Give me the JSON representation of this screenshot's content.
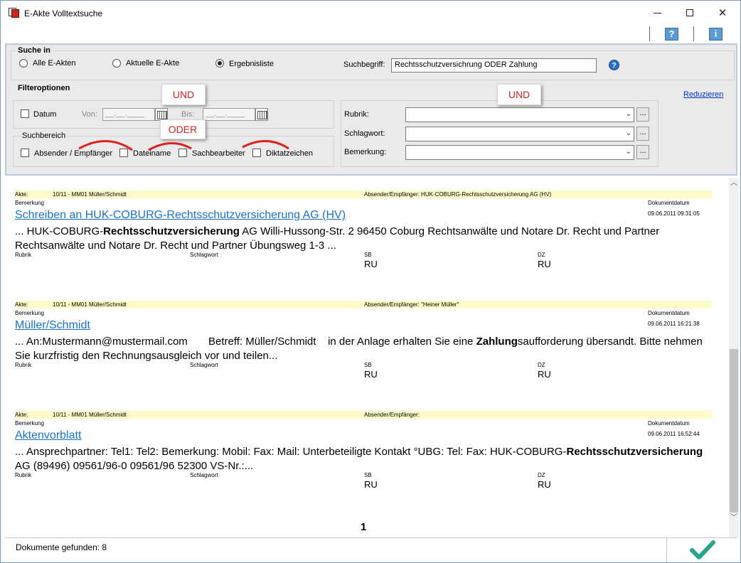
{
  "window": {
    "title": "E-Akte Volltextsuche"
  },
  "toolbar": {
    "help_label": "?",
    "info_label": "i"
  },
  "search_in": {
    "title": "Suche in",
    "options": [
      "Alle E-Akten",
      "Aktuelle E-Akte",
      "Ergebnisliste"
    ],
    "selected": "Ergebnisliste",
    "search_term_label": "Suchbegriff:",
    "search_term_value": "Rechtsschutzversichrung ODER Zahlung",
    "help_label": "?"
  },
  "filters": {
    "title": "Filteroptionen",
    "reduce_link": "Reduzieren",
    "date_label": "Datum",
    "from_label": "Von:",
    "from_value": "__.__.____",
    "to_label": "Bis:",
    "to_value": "__.__.____",
    "search_area_title": "Suchbereich",
    "search_area_items": [
      "Absender / Empfänger",
      "Dateiname",
      "Sachbearbeiter",
      "Diktatzeichen"
    ],
    "rubrik_label": "Rubrik:",
    "schlagwort_label": "Schlagwort:",
    "bemerkung_label": "Bemerkung:",
    "ellipsis": "..."
  },
  "annotations": {
    "und_left": "UND",
    "oder": "ODER",
    "und_right": "UND"
  },
  "results": [
    {
      "akte_label": "Akte:",
      "akte_value": "10/11 - MM01 Müller/Schmidt",
      "sender": "Absender/Empfänger: HUK-COBURG-Rechtsschutzversicherung AG (HV)",
      "bemerkung_label": "Bemerkung",
      "title": "Schreiben an HUK-COBURG-Rechtsschutzversicherung AG (HV)",
      "date_label": "Dokumentdatum",
      "date_value": "09.06.2011 09:31:05",
      "snippet_pre": "... HUK-COBURG-",
      "snippet_bold": "Rechtsschutzversicherung",
      "snippet_post": " AG Willi-Hussong-Str. 2 96450 Coburg Rechtsanwälte und Notare Dr. Recht und Partner Rechtsanwälte und Notare Dr. Recht und Partner Übungsweg 1-3 ...",
      "rubrik_label": "Rubrik",
      "schlagwort_label": "Schlagwort",
      "sb_label": "SB",
      "sb_value": "RU",
      "dz_label": "DZ",
      "dz_value": "RU"
    },
    {
      "akte_label": "Akte:",
      "akte_value": "10/11 - MM01 Müller/Schmidt",
      "sender": "Absender/Empfänger: \"Heiner Müller\"",
      "bemerkung_label": "Bemerkung",
      "title": "Müller/Schmidt",
      "date_label": "Dokumentdatum",
      "date_value": "09.06.2011 16:21:38",
      "snippet_pre": "... An:Mustermann@mustermail.com       Betreff: Müller/Schmidt    in der Anlage erhalten Sie eine ",
      "snippet_bold": "Zahlung",
      "snippet_post": "saufforderung übersandt. Bitte nehmen Sie kurzfristig den Rechnungsausgleich vor und teilen...",
      "rubrik_label": "Rubrik",
      "schlagwort_label": "Schlagwort",
      "sb_label": "SB",
      "sb_value": "RU",
      "dz_label": "DZ",
      "dz_value": "RU"
    },
    {
      "akte_label": "Akte:",
      "akte_value": "10/11 - MM01 Müller/Schmidt",
      "sender": "Absender/Empfänger:",
      "bemerkung_label": "Bemerkung",
      "title": "Aktenvorblatt",
      "date_label": "Dokumentdatum",
      "date_value": "09.06.2011 16:52:44",
      "snippet_pre": "... Ansprechpartner: Tel1: Tel2: Bemerkung: Mobil: Fax: Mail: Unterbeteiligte Kontakt °UBG: Tel: Fax: HUK-COBURG-",
      "snippet_bold": "Rechtsschutzversicherung",
      "snippet_post": " AG (89496) 09561/96-0 09561/96 52300 VS-Nr.:...",
      "rubrik_label": "Rubrik",
      "schlagwort_label": "Schlagwort",
      "sb_label": "SB",
      "sb_value": "RU",
      "dz_label": "DZ",
      "dz_value": "RU"
    }
  ],
  "pagination": {
    "current_page": "1"
  },
  "footer": {
    "status": "Dokumente gefunden: 8"
  },
  "colors": {
    "accent": "#1a73c8",
    "annotation": "#e02020",
    "highlight": "#fdfbc7",
    "ok": "#2aa58c"
  }
}
